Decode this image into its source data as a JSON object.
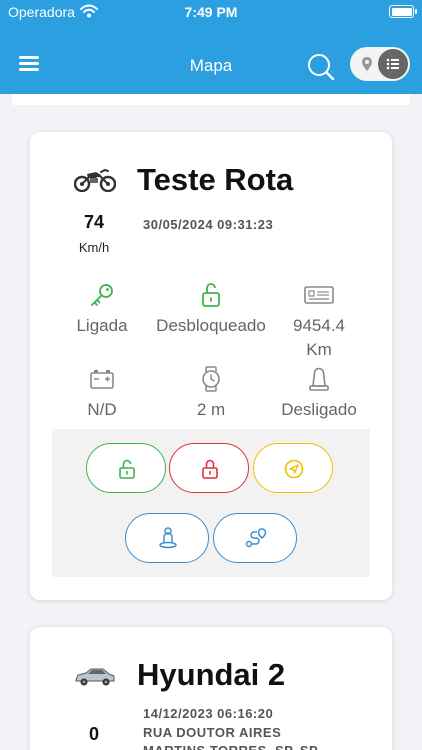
{
  "status_bar": {
    "carrier": "Operadora",
    "time": "7:49 PM"
  },
  "app_bar": {
    "title": "Mapa"
  },
  "colors": {
    "primary": "#2b9fe0",
    "green": "#3cb44b",
    "red": "#e0313b",
    "yellow": "#f0c000",
    "blue": "#3a8fd0"
  },
  "vehicles": [
    {
      "icon": "motorcycle-icon",
      "name": "Teste Rota",
      "speed": "74",
      "speed_unit": "Km/h",
      "timestamp": "30/05/2024 09:31:23",
      "stats": {
        "ignition": "Ligada",
        "lock": "Desbloqueado",
        "odometer": "9454.4",
        "odometer_unit": "Km",
        "battery": "N/D",
        "time": "2 m",
        "siren": "Desligado"
      },
      "actions": [
        "unlock-button",
        "lock-button",
        "navigate-button",
        "driver-button",
        "route-button"
      ]
    },
    {
      "icon": "car-icon",
      "name": "Hyundai 2",
      "speed": "0",
      "timestamp": "14/12/2023 06:16:20",
      "address_line1": "RUA DOUTOR AIRES",
      "address_line2": "MARTINS TORRES, SP, SP"
    }
  ]
}
